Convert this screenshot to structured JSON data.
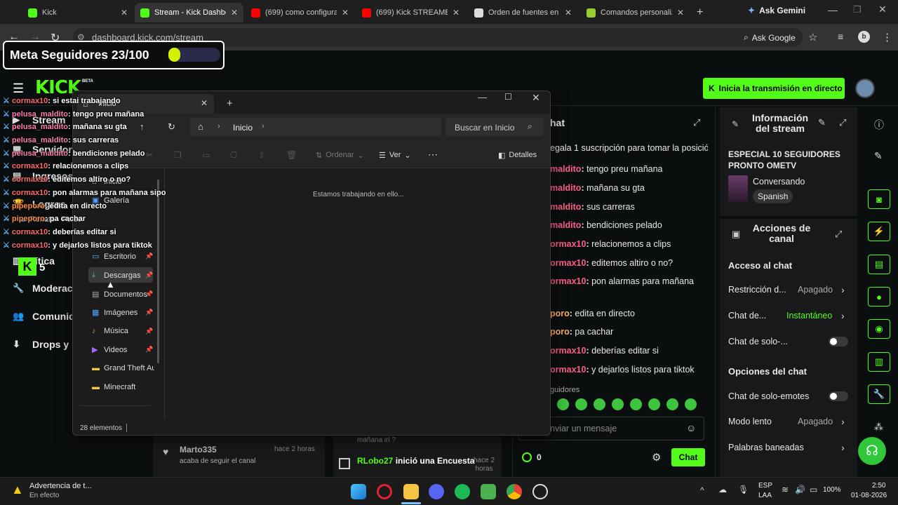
{
  "tabs": [
    {
      "title": "Kick",
      "color": "#53fc18",
      "active": false
    },
    {
      "title": "Stream - Kick Dashboard",
      "color": "#53fc18",
      "active": true
    },
    {
      "title": "(699) como configurar",
      "color": "#ff0000",
      "active": false
    },
    {
      "title": "(699) Kick STREAMER,",
      "color": "#ff0000",
      "active": false
    },
    {
      "title": "Orden de fuentes en O",
      "color": "#dddddd",
      "active": false
    },
    {
      "title": "Comandos personaliza",
      "color": "#9acd32",
      "active": false
    }
  ],
  "new_tab_symbol": "+",
  "ask_gemini": "Ask Gemini",
  "url": "dashboard.kick.com/stream",
  "ask_google": "Ask Google",
  "goal_widget": {
    "label": "Meta Seguidores 23/100",
    "progress": 0.23
  },
  "kick": {
    "logo": "KICK",
    "beta": "BETA",
    "go_live": "Inicia la transmisión en directo",
    "sidebar": [
      {
        "icon": "stream-icon",
        "label": "Stream"
      },
      {
        "icon": "server-icon",
        "label": "Servidor y"
      },
      {
        "icon": "income-icon",
        "label": "Ingresos"
      },
      {
        "icon": "achievements-icon",
        "label": "Logros"
      },
      {
        "icon": "analytics-icon",
        "label": "lítica"
      },
      {
        "icon": "wrench-icon",
        "label": "Moderac"
      },
      {
        "icon": "community-icon",
        "label": "Comunid"
      },
      {
        "icon": "drops-icon",
        "label": "Drops y r"
      }
    ],
    "badge_number": "5",
    "activity": [
      {
        "user": "Marto335",
        "text": "acaba de seguir el canal",
        "time": "hace 2 horas"
      },
      {
        "user": "RLobo27",
        "text": "inició una Encuesta",
        "time": "hace 2 horas",
        "prev": "mañana irl ?"
      }
    ],
    "chat": {
      "title": "hat",
      "pinned": "egala 1 suscripción para tomar la posició",
      "messages": [
        {
          "user": "maldito",
          "text": "tengo preu mañana"
        },
        {
          "user": "maldito",
          "text": "mañana su gta"
        },
        {
          "user": "maldito",
          "text": "sus carreras"
        },
        {
          "user": "maldito",
          "text": "bendiciones pelado"
        },
        {
          "user": "ormax10",
          "text": "relacionemos a clips"
        },
        {
          "user": "ormax10",
          "text": "editemos altiro o no?"
        },
        {
          "user": "ormax10",
          "text": "pon alarmas para mañana"
        },
        {
          "user": "poro",
          "text": "edita en directo"
        },
        {
          "user": "poro",
          "text": "pa cachar"
        },
        {
          "user": "ormax10",
          "text": "deberías editar si"
        },
        {
          "user": "ormax10",
          "text": "y dejarlos listos para tiktok"
        }
      ],
      "followers_label": "guidores",
      "input_placeholder": "nviar un mensaje",
      "points": "0",
      "send_label": "Chat"
    },
    "stream_info": {
      "title": "Información del stream",
      "stream_title": "ESPECIAL 10 SEGUIDORES PRONTO OMETV",
      "category": "Conversando",
      "language": "Spanish"
    },
    "channel_actions": {
      "title": "Acciones de canal",
      "chat_access": "Acceso al chat",
      "restriction_label": "Restricción d...",
      "restriction_value": "Apagado",
      "chat_delay_label": "Chat de...",
      "chat_delay_value": "Instantáneo",
      "chat_only_label": "Chat de solo-...",
      "chat_options": "Opciones del chat",
      "emotes_only_label": "Chat de solo-emotes",
      "slow_mode_label": "Modo lento",
      "slow_mode_value": "Apagado",
      "banned_words_label": "Palabras baneadas"
    }
  },
  "explorer": {
    "tab_title": "Inicio",
    "breadcrumb": "Inicio",
    "search_placeholder": "Buscar en Inicio",
    "sort_label": "Ordenar",
    "view_label": "Ver",
    "details_label": "Detalles",
    "loading_text": "Estamos trabajando en ello...",
    "status": "28 elementos",
    "nav": [
      {
        "label": "Inicio",
        "icon": "home-icon",
        "pinned": false
      },
      {
        "label": "Galería",
        "icon": "gallery-icon",
        "pinned": false
      },
      {
        "label": "Renato - Personal",
        "icon": "onedrive-icon",
        "pinned": false
      },
      {
        "label": "Escritorio",
        "icon": "desktop-icon",
        "pinned": true
      },
      {
        "label": "Descargas",
        "icon": "download-icon",
        "pinned": true
      },
      {
        "label": "Documentos",
        "icon": "documents-icon",
        "pinned": true
      },
      {
        "label": "Imágenes",
        "icon": "pictures-icon",
        "pinned": true
      },
      {
        "label": "Música",
        "icon": "music-icon",
        "pinned": true
      },
      {
        "label": "Videos",
        "icon": "videos-icon",
        "pinned": true
      },
      {
        "label": "Grand Theft Aut",
        "icon": "folder-icon",
        "pinned": false
      },
      {
        "label": "Minecraft",
        "icon": "folder-icon",
        "pinned": false
      }
    ]
  },
  "chat_overlay": [
    {
      "user": "cormax10",
      "text": "si estai trabajando"
    },
    {
      "user": "pelusa_maldito",
      "text": "tengo preu mañana"
    },
    {
      "user": "pelusa_maldito",
      "text": "mañana su gta"
    },
    {
      "user": "pelusa_maldito",
      "text": "sus carreras"
    },
    {
      "user": "pelusa_maldito",
      "text": "bendiciones pelado"
    },
    {
      "user": "cormax10",
      "text": "relacionemos a clips"
    },
    {
      "user": "cormax10",
      "text": "editemos altiro o no?"
    },
    {
      "user": "cormax10",
      "text": "pon alarmas para mañana sipo"
    },
    {
      "user": "pipeporo",
      "text": "edita en directo"
    },
    {
      "user": "pipeporo",
      "text": "pa cachar"
    },
    {
      "user": "cormax10",
      "text": "deberías editar si"
    },
    {
      "user": "cormax10",
      "text": "y dejarlos listos para tiktok"
    }
  ],
  "taskbar": {
    "weather_title": "Advertencia de t...",
    "weather_sub": "En efecto",
    "lang": "ESP",
    "lang2": "LAA",
    "battery": "100%",
    "time": "2:50",
    "date": "01-08-2026"
  }
}
